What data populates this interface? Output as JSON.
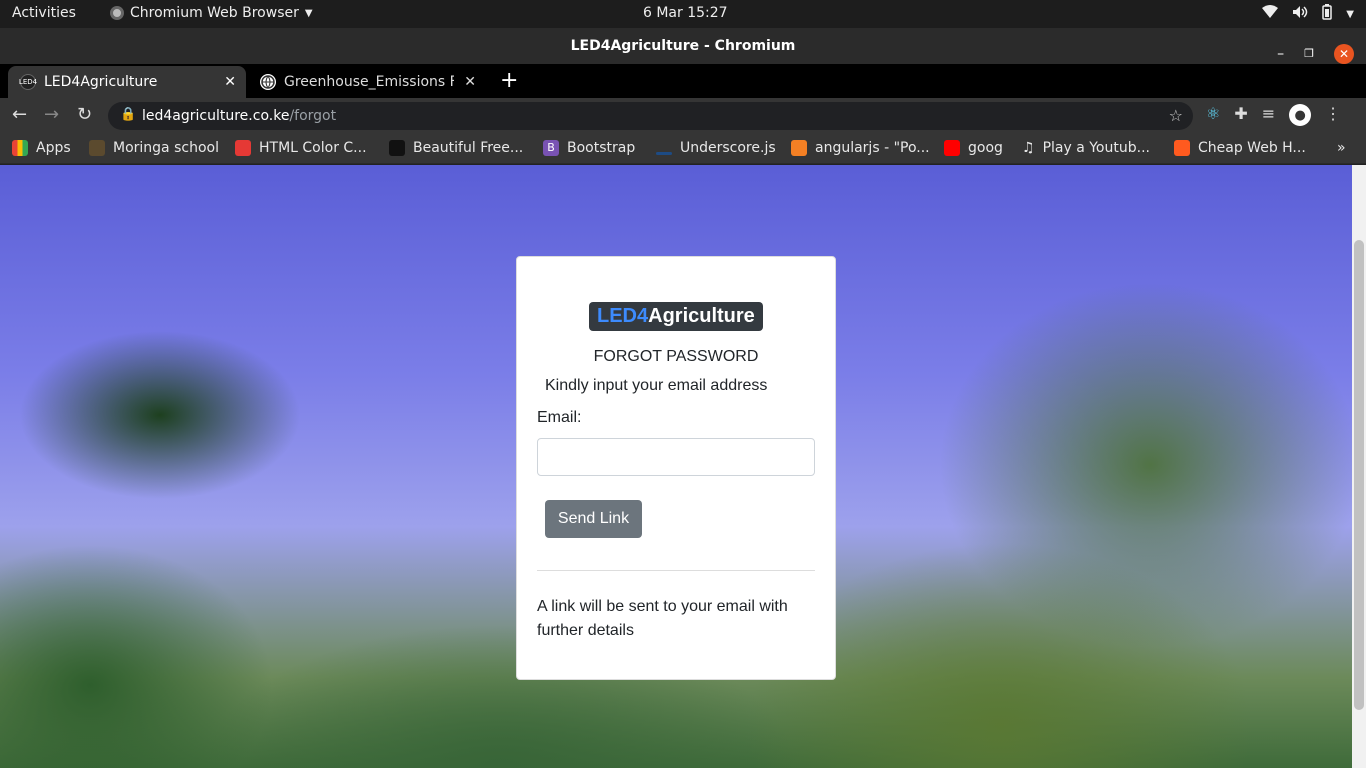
{
  "system_bar": {
    "activities": "Activities",
    "app_name": "Chromium Web Browser",
    "clock": "6 Mar  15:27"
  },
  "window": {
    "title": "LED4Agriculture - Chromium"
  },
  "tabs": [
    {
      "label": "LED4Agriculture",
      "favicon_text": "LED4",
      "active": true
    },
    {
      "label": "Greenhouse_Emissions Fa",
      "active": false
    }
  ],
  "address_bar": {
    "host": "led4agriculture.co.ke",
    "path": "/forgot"
  },
  "bookmarks": [
    {
      "label": "Apps",
      "color": "#4285f4"
    },
    {
      "label": "Moringa school",
      "color": "#5b4a2e"
    },
    {
      "label": "HTML Color C...",
      "color": "#e53935"
    },
    {
      "label": "Beautiful Free...",
      "color": "#111111"
    },
    {
      "label": "Bootstrap",
      "color": "#7952b3"
    },
    {
      "label": "Underscore.js",
      "color": "#1d4b84"
    },
    {
      "label": "angularjs - \"Po...",
      "color": "#f48024"
    },
    {
      "label": "goog",
      "color": "#ff0000"
    },
    {
      "label": "Play a Youtub...",
      "color": "#333333"
    },
    {
      "label": "Cheap Web H...",
      "color": "#ff5a1f"
    }
  ],
  "bookmarks_overflow": "»",
  "page": {
    "brand_part1": "LED4",
    "brand_part2": "Agriculture",
    "heading": "FORGOT PASSWORD",
    "subheading": "Kindly input your email address",
    "email_label": "Email:",
    "email_value": "",
    "send_button": "Send Link",
    "note": "A link will be sent to your email with further details"
  },
  "colors": {
    "brand_accent": "#3d8bfd",
    "brand_bg": "#343a40",
    "button_bg": "#6c757d",
    "close_button": "#e95420"
  }
}
